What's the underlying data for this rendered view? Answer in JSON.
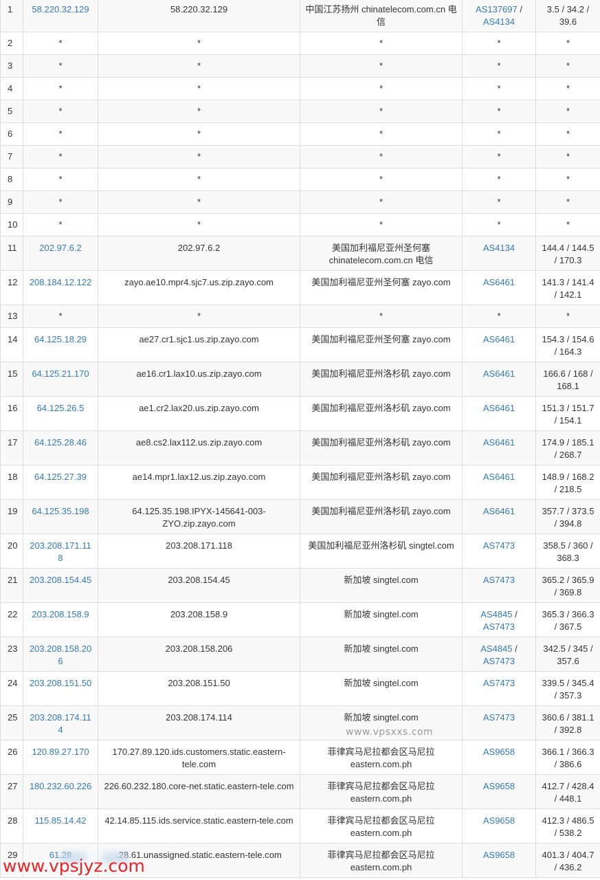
{
  "hops": [
    {
      "hop": "1",
      "ip": "58.220.32.129",
      "host": "58.220.32.129",
      "location": "中国江苏扬州 chinatelecom.com.cn 电信",
      "asn": [
        "AS137697",
        "AS4134"
      ],
      "latency": "3.5 / 34.2 / 39.6"
    },
    {
      "hop": "2",
      "ip": "*",
      "host": "*",
      "location": "*",
      "asn": [
        "*"
      ],
      "latency": "*"
    },
    {
      "hop": "3",
      "ip": "*",
      "host": "*",
      "location": "*",
      "asn": [
        "*"
      ],
      "latency": "*"
    },
    {
      "hop": "4",
      "ip": "*",
      "host": "*",
      "location": "*",
      "asn": [
        "*"
      ],
      "latency": "*"
    },
    {
      "hop": "5",
      "ip": "*",
      "host": "*",
      "location": "*",
      "asn": [
        "*"
      ],
      "latency": "*"
    },
    {
      "hop": "6",
      "ip": "*",
      "host": "*",
      "location": "*",
      "asn": [
        "*"
      ],
      "latency": "*"
    },
    {
      "hop": "7",
      "ip": "*",
      "host": "*",
      "location": "*",
      "asn": [
        "*"
      ],
      "latency": "*"
    },
    {
      "hop": "8",
      "ip": "*",
      "host": "*",
      "location": "*",
      "asn": [
        "*"
      ],
      "latency": "*"
    },
    {
      "hop": "9",
      "ip": "*",
      "host": "*",
      "location": "*",
      "asn": [
        "*"
      ],
      "latency": "*"
    },
    {
      "hop": "10",
      "ip": "*",
      "host": "*",
      "location": "*",
      "asn": [
        "*"
      ],
      "latency": "*"
    },
    {
      "hop": "11",
      "ip": "202.97.6.2",
      "host": "202.97.6.2",
      "location": "美国加利福尼亚州圣何塞 chinatelecom.com.cn 电信",
      "asn": [
        "AS4134"
      ],
      "latency": "144.4 / 144.5 / 170.3"
    },
    {
      "hop": "12",
      "ip": "208.184.12.122",
      "host": "zayo.ae10.mpr4.sjc7.us.zip.zayo.com",
      "location": "美国加利福尼亚州圣何塞 zayo.com",
      "asn": [
        "AS6461"
      ],
      "latency": "141.3 / 141.4 / 142.1"
    },
    {
      "hop": "13",
      "ip": "*",
      "host": "*",
      "location": "*",
      "asn": [
        "*"
      ],
      "latency": "*"
    },
    {
      "hop": "14",
      "ip": "64.125.18.29",
      "host": "ae27.cr1.sjc1.us.zip.zayo.com",
      "location": "美国加利福尼亚州圣何塞 zayo.com",
      "asn": [
        "AS6461"
      ],
      "latency": "154.3 / 154.6 / 164.3"
    },
    {
      "hop": "15",
      "ip": "64.125.21.170",
      "host": "ae16.cr1.lax10.us.zip.zayo.com",
      "location": "美国加利福尼亚州洛杉矶 zayo.com",
      "asn": [
        "AS6461"
      ],
      "latency": "166.6 / 168 / 168.1"
    },
    {
      "hop": "16",
      "ip": "64.125.26.5",
      "host": "ae1.cr2.lax20.us.zip.zayo.com",
      "location": "美国加利福尼亚州洛杉矶 zayo.com",
      "asn": [
        "AS6461"
      ],
      "latency": "151.3 / 151.7 / 154.1"
    },
    {
      "hop": "17",
      "ip": "64.125.28.46",
      "host": "ae8.cs2.lax112.us.zip.zayo.com",
      "location": "美国加利福尼亚州洛杉矶 zayo.com",
      "asn": [
        "AS6461"
      ],
      "latency": "174.9 / 185.1 / 268.7"
    },
    {
      "hop": "18",
      "ip": "64.125.27.39",
      "host": "ae14.mpr1.lax12.us.zip.zayo.com",
      "location": "美国加利福尼亚州洛杉矶 zayo.com",
      "asn": [
        "AS6461"
      ],
      "latency": "148.9 / 168.2 / 218.5"
    },
    {
      "hop": "19",
      "ip": "64.125.35.198",
      "host": "64.125.35.198.IPYX-145641-003-ZYO.zip.zayo.com",
      "location": "美国加利福尼亚州洛杉矶 zayo.com",
      "asn": [
        "AS6461"
      ],
      "latency": "357.7 / 373.5 / 394.8"
    },
    {
      "hop": "20",
      "ip": "203.208.171.118",
      "host": "203.208.171.118",
      "location": "美国加利福尼亚州洛杉矶 singtel.com",
      "asn": [
        "AS7473"
      ],
      "latency": "358.5 / 360 / 368.3"
    },
    {
      "hop": "21",
      "ip": "203.208.154.45",
      "host": "203.208.154.45",
      "location": "新加坡 singtel.com",
      "asn": [
        "AS7473"
      ],
      "latency": "365.2 / 365.9 / 369.8"
    },
    {
      "hop": "22",
      "ip": "203.208.158.9",
      "host": "203.208.158.9",
      "location": "新加坡 singtel.com",
      "asn": [
        "AS4845",
        "AS7473"
      ],
      "latency": "365.3 / 366.3 / 367.5"
    },
    {
      "hop": "23",
      "ip": "203.208.158.206",
      "host": "203.208.158.206",
      "location": "新加坡 singtel.com",
      "asn": [
        "AS4845",
        "AS7473"
      ],
      "latency": "342.5 / 345 / 357.6"
    },
    {
      "hop": "24",
      "ip": "203.208.151.50",
      "host": "203.208.151.50",
      "location": "新加坡 singtel.com",
      "asn": [
        "AS7473"
      ],
      "latency": "339.5 / 345.4 / 357.3"
    },
    {
      "hop": "25",
      "ip": "203.208.174.114",
      "host": "203.208.174.114",
      "location": "新加坡 singtel.com",
      "asn": [
        "AS7473"
      ],
      "latency": "360.6 / 381.1 / 392.8"
    },
    {
      "hop": "26",
      "ip": "120.89.27.170",
      "host": "170.27.89.120.ids.customers.static.eastern-tele.com",
      "location": "菲律宾马尼拉都会区马尼拉 eastern.com.ph",
      "asn": [
        "AS9658"
      ],
      "latency": "366.1 / 366.3 / 386.6"
    },
    {
      "hop": "27",
      "ip": "180.232.60.226",
      "host": "226.60.232.180.core-net.static.eastern-tele.com",
      "location": "菲律宾马尼拉都会区马尼拉 eastern.com.ph",
      "asn": [
        "AS9658"
      ],
      "latency": "412.7 / 428.4 / 448.1"
    },
    {
      "hop": "28",
      "ip": "115.85.14.42",
      "host": "42.14.85.115.ids.service.static.eastern-tele.com",
      "location": "菲律宾马尼拉都会区马尼拉 eastern.com.ph",
      "asn": [
        "AS9658"
      ],
      "latency": "412.3 / 486.5 / 538.2"
    },
    {
      "hop": "29",
      "ip": "61.28",
      "host": ".28.61.unassigned.static.eastern-tele.com",
      "location": "菲律宾马尼拉都会区马尼拉 eastern.com.ph",
      "asn": [
        "AS9658"
      ],
      "latency": "401.3 / 404.7 / 436.2"
    }
  ],
  "watermarks": {
    "center": "www.vpsxxs.com",
    "bottom": "www.vpsjyz.com"
  },
  "colors": {
    "link": "#337ab7",
    "watermark_red": "#ee2222",
    "row_stripe": "#f9f9f9",
    "border": "#dddddd"
  }
}
